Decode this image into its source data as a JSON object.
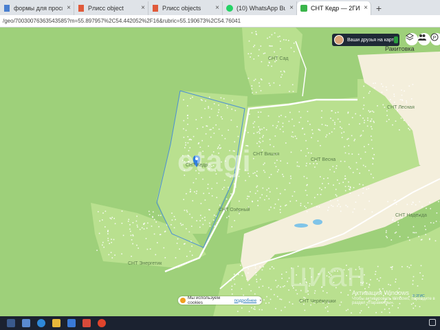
{
  "browser": {
    "tabs": [
      {
        "label": "формы для просм",
        "favicon": "doc",
        "active": false
      },
      {
        "label": "Рлисс object",
        "favicon": "doc",
        "active": false
      },
      {
        "label": "Рлисс objects",
        "favicon": "doc",
        "active": false
      },
      {
        "label": "(10) WhatsApp Business",
        "favicon": "whatsapp",
        "active": false
      },
      {
        "label": "СНТ Кедр — 2ГИС",
        "favicon": "2gis",
        "active": true
      }
    ],
    "new_tab_label": "+",
    "close_glyph": "×",
    "url": "/geo/70030076363543585?m=55.897957%2C54.442052%2F16&rubric=55.190673%2C54.76041"
  },
  "map": {
    "friends_banner": "Ваши друзья на карте!",
    "village_label": "Ракитовка",
    "plot_labels": [
      "СНТ Кедр",
      "СНТ Вишня",
      "СНТ Сад",
      "СНТ Озёрный",
      "СНТ Весна",
      "СНТ Лесная",
      "СНТ Энергетик",
      "СНТ Черёмушки",
      "СНТ Надежда"
    ],
    "watermark_1": "etagi",
    "watermark_2": "циан",
    "cookie_notice": {
      "text": "Мы используем cookies",
      "link": "подробнее",
      "close": "×"
    },
    "windows_activate": {
      "title": "Активация Windows",
      "subtitle": "Чтобы активировать Windows, перейдите в раздел «Параметры»."
    },
    "copyright": "© 2ГИС",
    "colors": {
      "forest": "#9ed07a",
      "clearing": "#b9e08f",
      "field": "#f4efdc",
      "water": "#7fc4e8",
      "road": "#ffffff",
      "border": "#4a8ed6",
      "pin": "#2f7fe0"
    }
  },
  "tools": [
    {
      "icon": "layers-icon"
    },
    {
      "icon": "friends-icon"
    },
    {
      "icon": "parking-icon"
    }
  ],
  "taskbar": {
    "time": "",
    "icons": [
      "start-icon",
      "weather-icon",
      "edge-icon",
      "explorer-icon",
      "store-icon",
      "mail-icon",
      "yandex-icon"
    ]
  }
}
